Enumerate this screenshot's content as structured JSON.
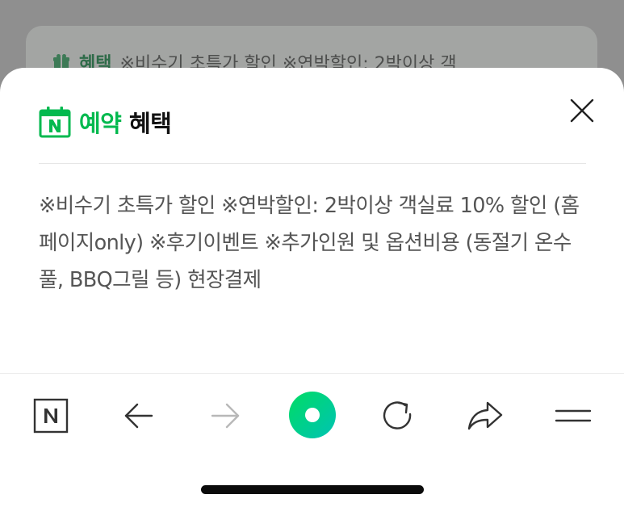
{
  "background": {
    "label": "혜택",
    "text": "※비수기 초특가 할인 ※연박할인: 2박이상 객",
    "icon": "gift-icon"
  },
  "sheet": {
    "title_accent": "예약",
    "title_rest": " 혜택",
    "title_icon": "naver-calendar-icon",
    "close_icon": "close-icon",
    "description": "※비수기 초특가 할인 ※연박할인: 2박이상 객실료 10% 할인 (홈페이지only) ※후기이벤트 ※추가인원 및 옵션비용 (동절기 온수풀, BBQ그릴 등) 현장결제"
  },
  "toolbar": {
    "items": [
      {
        "name": "naver-home-icon"
      },
      {
        "name": "back-arrow-icon"
      },
      {
        "name": "forward-arrow-icon",
        "disabled": true
      },
      {
        "name": "green-dot-icon"
      },
      {
        "name": "refresh-icon"
      },
      {
        "name": "share-icon"
      },
      {
        "name": "menu-icon"
      }
    ]
  },
  "colors": {
    "accent": "#03b94f",
    "text": "#555555",
    "dim_overlay": "#8f8f8f"
  }
}
